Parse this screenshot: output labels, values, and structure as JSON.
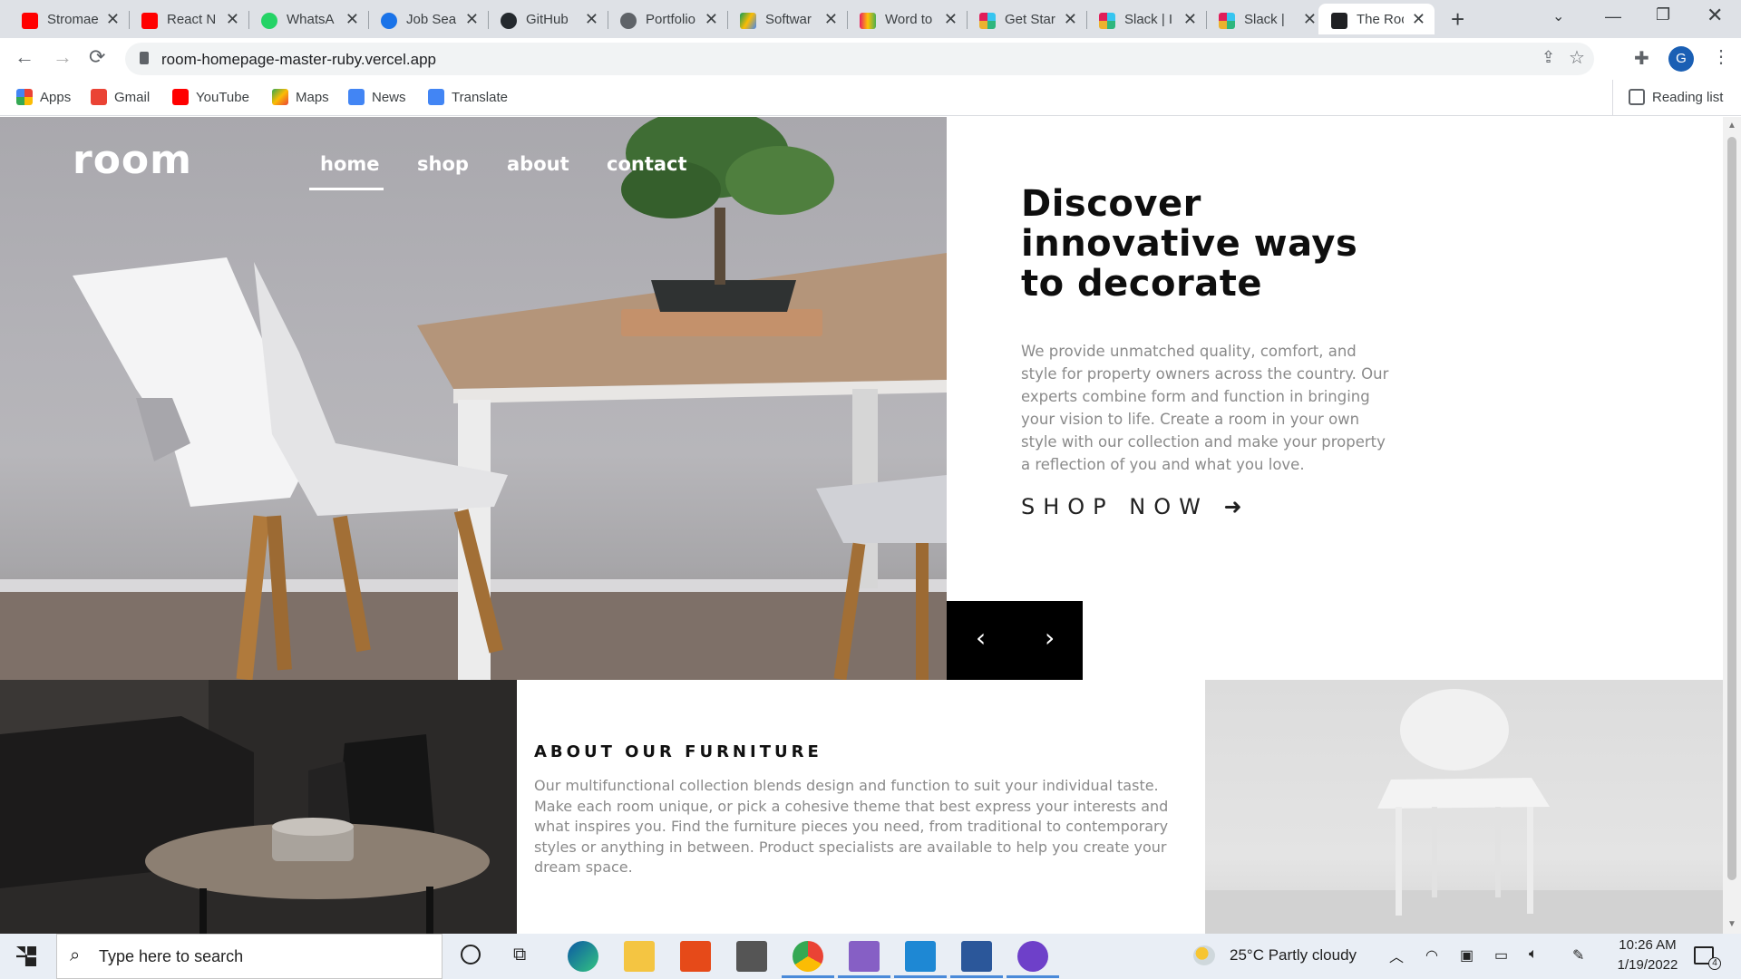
{
  "browser": {
    "tabs": [
      {
        "label": "Stromae",
        "color": "#ff0000"
      },
      {
        "label": "React N",
        "color": "#ff0000"
      },
      {
        "label": "WhatsA",
        "color": "#25d366"
      },
      {
        "label": "Job Sea",
        "color": "#1a73e8"
      },
      {
        "label": "GitHub",
        "color": "#24292e"
      },
      {
        "label": "Portfolio",
        "color": "#5f6368"
      },
      {
        "label": "Softwar",
        "color": "#fbbc04"
      },
      {
        "label": "Word to",
        "color": "#9c27b0"
      },
      {
        "label": "Get Star",
        "color": "#e01e5a"
      },
      {
        "label": "Slack | I",
        "color": "#e01e5a"
      },
      {
        "label": "Slack |",
        "color": "#e01e5a"
      },
      {
        "label": "The Roo",
        "color": "#202124"
      }
    ],
    "new_tab_icon": "+",
    "url": "room-homepage-master-ruby.vercel.app",
    "profile_initial": "G",
    "bookmarks": [
      {
        "label": "Apps"
      },
      {
        "label": "Gmail"
      },
      {
        "label": "YouTube"
      },
      {
        "label": "Maps"
      },
      {
        "label": "News"
      },
      {
        "label": "Translate"
      }
    ],
    "reading_list": "Reading list"
  },
  "site": {
    "logo": "room",
    "nav": {
      "home": "home",
      "shop": "shop",
      "about": "about",
      "contact": "contact"
    },
    "hero": {
      "title": "Discover innovative ways to decorate",
      "body": "We provide unmatched quality, comfort, and style for property owners across the country. Our experts combine form and function in bringing your vision to life. Create a room in your own style with our collection and make your property a reflection of you and what you love.",
      "cta": "SHOP NOW",
      "cta_arrow": "➜",
      "prev": "‹",
      "next": "›"
    },
    "about": {
      "title": "ABOUT OUR FURNITURE",
      "body": "Our multifunctional collection blends design and function to suit your individual taste. Make each room unique, or pick a cohesive theme that best express your interests and what inspires you. Find the furniture pieces you need, from traditional to contemporary styles or anything in between. Product specialists are available to help you create your dream space."
    }
  },
  "taskbar": {
    "search_placeholder": "Type here to search",
    "weather": "25°C  Partly cloudy",
    "time": "10:26 AM",
    "date": "1/19/2022",
    "notifications": "4"
  }
}
